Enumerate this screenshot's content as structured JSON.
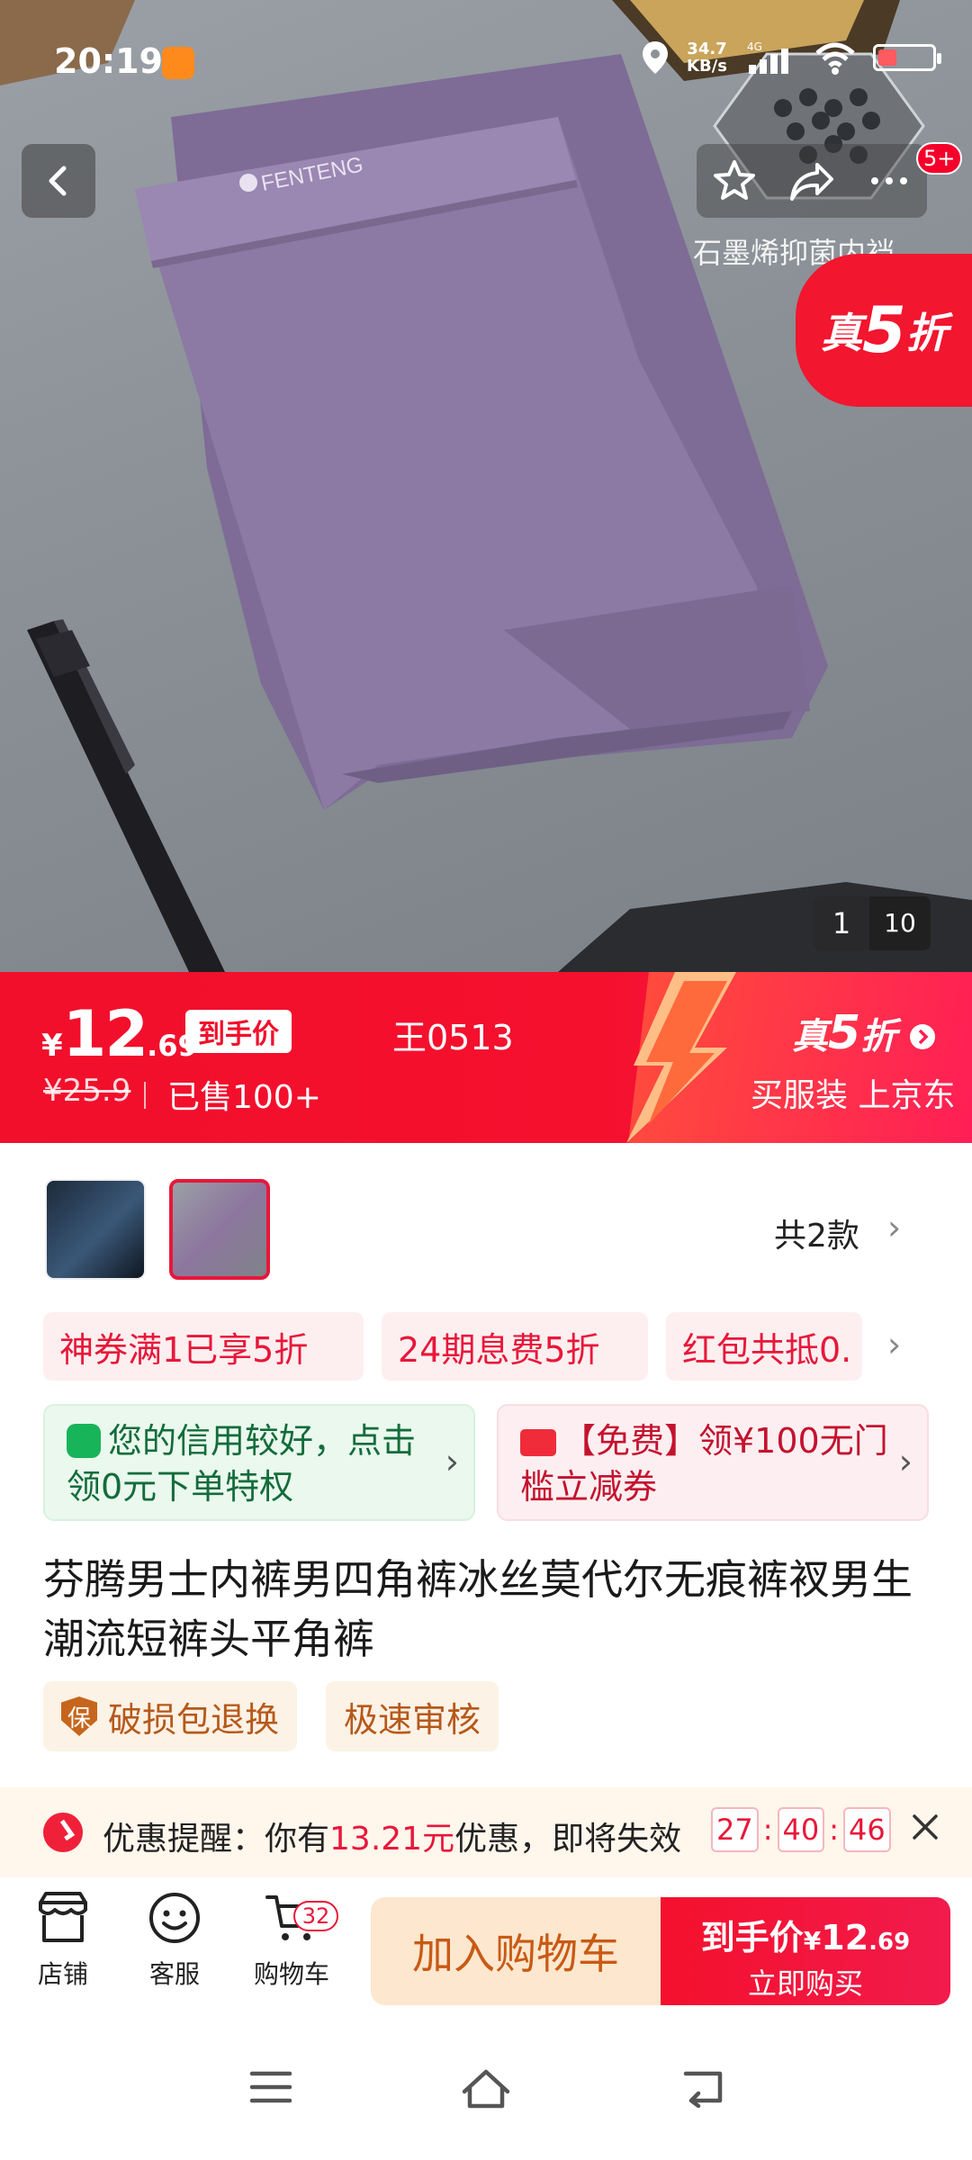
{
  "status_bar": {
    "time": "20:19",
    "speed_value": "34.7",
    "speed_unit": "KB/s",
    "network": "4G",
    "battery_level": 0.35
  },
  "hero": {
    "brand_print": "FENTENG",
    "caption": "石墨烯抑菌内裆",
    "promo": {
      "prefix": "真",
      "big": "5",
      "suffix": "折"
    },
    "message_badge": "5+",
    "page_current": "1",
    "page_total": "10"
  },
  "price": {
    "yen": "¥",
    "integer": "12",
    "decimal": ".69",
    "tag": "到手价",
    "code": "王0513",
    "original": "¥25.9",
    "sold": "已售100+",
    "banner_title_prefix": "真",
    "banner_title_big": "5",
    "banner_title_suffix": "折",
    "banner_subtitle": "买服装 上京东"
  },
  "styles": {
    "count_label": "共2款"
  },
  "coupons": [
    {
      "label": "神券满1已享5折"
    },
    {
      "label": "24期息费5折"
    },
    {
      "label": "红包共抵0."
    }
  ],
  "cards": {
    "credit": "您的信用较好，点击领0元下单特权",
    "voucher": "【免费】领¥100无门槛立减券"
  },
  "product": {
    "title": "芬腾男士内裤男四角裤冰丝莫代尔无痕裤衩男生潮流短裤头平角裤"
  },
  "services": [
    {
      "icon_text": "保",
      "label": "破损包退换"
    },
    {
      "label": "极速审核"
    }
  ],
  "reminder": {
    "prefix": "优惠提醒：你有",
    "amount": "13.21元",
    "suffix": "优惠，即将失效",
    "hours": "27",
    "minutes": "40",
    "seconds": "46"
  },
  "action_bar": {
    "store": "店铺",
    "service": "客服",
    "cart": "购物车",
    "cart_count": "32",
    "add_to_cart": "加入购物车",
    "buy_prefix": "到手价",
    "buy_yen": "¥",
    "buy_int": "12",
    "buy_dec": ".69",
    "buy_now": "立即购买"
  },
  "icons": {
    "back": "chevron-left-icon",
    "favorite": "star-icon",
    "share": "share-icon",
    "more": "more-icon",
    "store": "store-icon",
    "service": "smile-icon",
    "cart": "cart-icon",
    "menu": "menu-icon",
    "home": "home-icon",
    "return": "back-arrow-icon"
  },
  "colors": {
    "brand_red": "#f10f2b",
    "promo_pink": "#ff1e55",
    "cart_button_bg": "#fde7cf",
    "success_green": "#18b45a"
  }
}
